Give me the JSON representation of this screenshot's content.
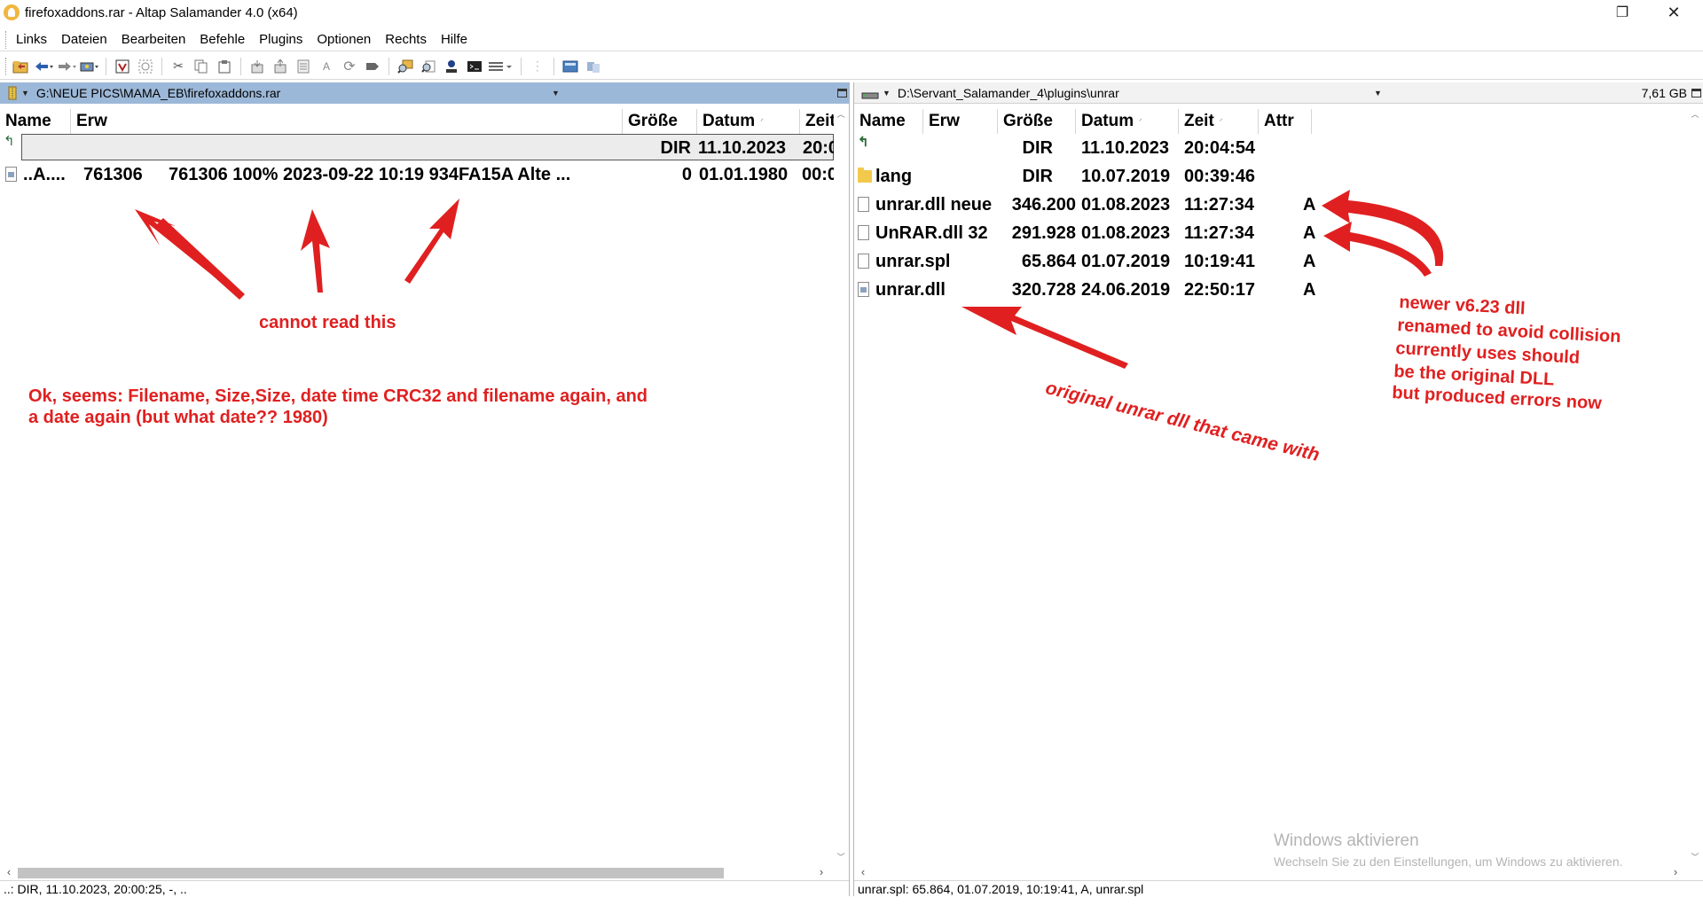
{
  "window": {
    "title": "firefoxaddons.rar - Altap Salamander 4.0 (x64)",
    "restore_glyph": "❐",
    "close_glyph": "✕"
  },
  "menu": [
    "Links",
    "Dateien",
    "Bearbeiten",
    "Befehle",
    "Plugins",
    "Optionen",
    "Rechts",
    "Hilfe"
  ],
  "toolbar_icons": [
    "open-folder-icon",
    "back-icon",
    "forward-icon",
    "drive-icon",
    "select-icon",
    "unselect-icon",
    "cut-icon",
    "copy-icon",
    "paste-icon",
    "pack-icon",
    "unpack-icon",
    "properties-icon",
    "rename-icon",
    "refresh-icon",
    "tag-icon",
    "find-icon",
    "find-files-icon",
    "user-icon",
    "console-icon",
    "view-mode-icon",
    "network-icon",
    "panel-icon"
  ],
  "left_panel": {
    "path": "G:\\NEUE PICS\\MAMA_EB\\firefoxaddons.rar",
    "columns": [
      "Name",
      "Erw",
      "Größe",
      "Datum",
      "Zeit"
    ],
    "updir": {
      "size": "DIR",
      "date": "11.10.2023",
      "time": "20:0"
    },
    "rows": [
      {
        "name": "..A....",
        "erw": "761306",
        "size": "0",
        "date": "01.01.1980",
        "time": "00:0",
        "extra": "761306 100%  2023-09-22 10:19  934FA15A  Alte ..."
      }
    ],
    "status": "..: DIR, 11.10.2023, 20:00:25, -, .."
  },
  "right_panel": {
    "path": "D:\\Servant_Salamander_4\\plugins\\unrar",
    "free_space": "7,61 GB",
    "columns": [
      "Name",
      "Erw",
      "Größe",
      "Datum",
      "Zeit",
      "Attr"
    ],
    "updir": {
      "size": "DIR",
      "date": "11.10.2023",
      "time": "20:04:54"
    },
    "rows": [
      {
        "name": "lang",
        "erw": "",
        "size": "DIR",
        "date": "10.07.2019",
        "time": "00:39:46",
        "attr": "",
        "kind": "folder"
      },
      {
        "name": "unrar.dll neue",
        "erw": "",
        "size": "346.200",
        "date": "01.08.2023",
        "time": "11:27:34",
        "attr": "A",
        "kind": "file"
      },
      {
        "name": "UnRAR.dll 32",
        "erw": "",
        "size": "291.928",
        "date": "01.08.2023",
        "time": "11:27:34",
        "attr": "A",
        "kind": "file"
      },
      {
        "name": "unrar.spl",
        "erw": "",
        "size": "65.864",
        "date": "01.07.2019",
        "time": "10:19:41",
        "attr": "A",
        "kind": "file"
      },
      {
        "name": "unrar.dll",
        "erw": "",
        "size": "320.728",
        "date": "24.06.2019",
        "time": "22:50:17",
        "attr": "A",
        "kind": "image"
      }
    ],
    "status": "unrar.spl: 65.864, 01.07.2019, 10:19:41, A, unrar.spl"
  },
  "annotations": {
    "cannot_read": "cannot read this",
    "seems_line1": "Ok, seems: Filename, Size,Size, date time CRC32 and filename again, and",
    "seems_line2": "a date again (but what date?? 1980)",
    "original": "original unrar dll that came with",
    "newer_line1": "newer v6.23 dll",
    "newer_line2": "renamed to avoid collision",
    "newer_line3": "currently uses should",
    "newer_line4": "be the original DLL",
    "newer_line5": "but produced errors now",
    "color": "#e02020"
  },
  "watermark": {
    "title": "Windows aktivieren",
    "subtitle": "Wechseln Sie zu den Einstellungen, um Windows zu aktivieren."
  },
  "colors": {
    "active_pathbar": "#9cb8d8",
    "annotation": "#e02020"
  }
}
